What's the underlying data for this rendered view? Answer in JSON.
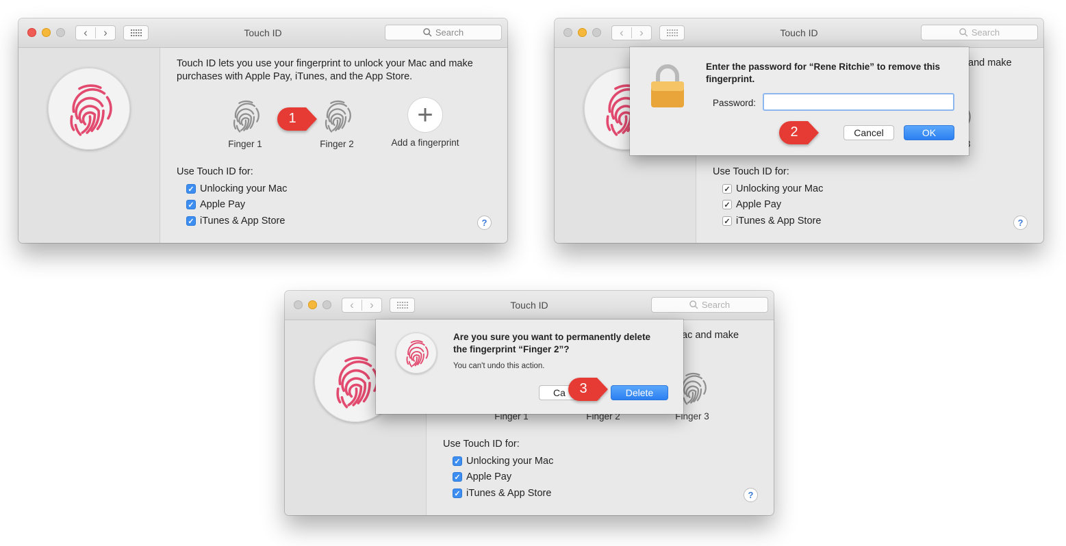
{
  "window": {
    "title": "Touch ID",
    "search_placeholder": "Search",
    "intro": "Touch ID lets you use your fingerprint to unlock your Mac and make purchases with Apple Pay, iTunes, and the App Store.",
    "fingers": [
      "Finger 1",
      "Finger 2",
      "Finger 3"
    ],
    "add_fingerprint": "Add a fingerprint",
    "use_for_label": "Use Touch ID for:",
    "options": [
      "Unlocking your Mac",
      "Apple Pay",
      "iTunes & App Store"
    ],
    "help_label": "?",
    "back_glyph": "‹",
    "forward_glyph": "›"
  },
  "colors": {
    "traffic_close": "#ee5c55",
    "traffic_minimize": "#f6b83a",
    "traffic_inactive": "#cdcdcd",
    "fingerprint_pink": "#e24a6f",
    "checkbox_blue": "#3d8ef0",
    "step_marker_red": "#e63b34"
  },
  "cropped_text": {
    "intro_tail_1": "and make",
    "finger3_tail_1": "3",
    "intro_tail_3": "ac and make",
    "cancel_partial": "Ca"
  },
  "password_dialog": {
    "message": "Enter the password for “Rene Ritchie” to remove this fingerprint.",
    "password_label": "Password:",
    "password_value": "",
    "cancel": "Cancel",
    "ok": "OK"
  },
  "delete_dialog": {
    "message": "Are you sure you want to permanently delete the fingerprint “Finger 2”?",
    "sub": "You can't undo this action.",
    "delete": "Delete"
  },
  "steps": [
    "1",
    "2",
    "3"
  ],
  "icons": {
    "lock": "lock-icon",
    "fingerprint": "fingerprint-icon",
    "search": "search-icon",
    "grid": "grid-icon",
    "help": "help-icon",
    "add": "plus-icon"
  }
}
